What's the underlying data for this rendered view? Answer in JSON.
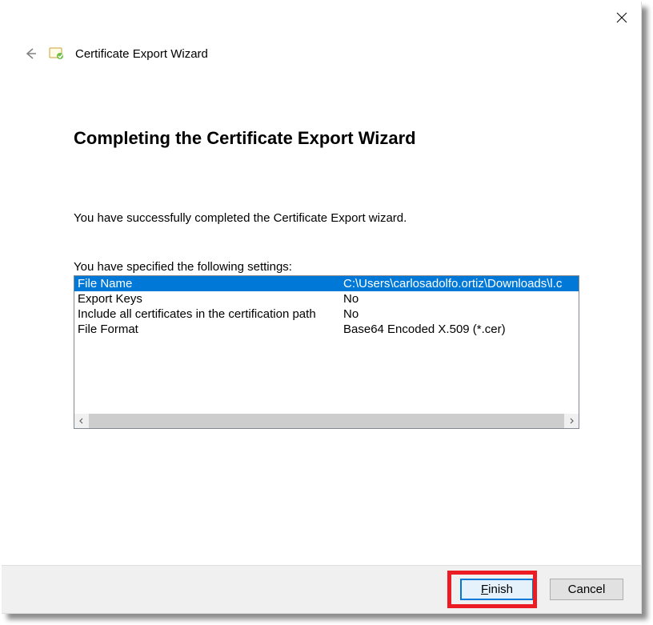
{
  "titlebar": {
    "close_tooltip": "Close"
  },
  "header": {
    "back_tooltip": "Back",
    "wizard_title": "Certificate Export Wizard"
  },
  "content": {
    "heading": "Completing the Certificate Export Wizard",
    "success_text": "You have successfully completed the Certificate Export wizard.",
    "settings_label": "You have specified the following settings:",
    "settings_rows": [
      {
        "key": "File Name",
        "value": "C:\\Users\\carlosadolfo.ortiz\\Downloads\\l.c",
        "selected": true
      },
      {
        "key": "Export Keys",
        "value": "No",
        "selected": false
      },
      {
        "key": "Include all certificates in the certification path",
        "value": "No",
        "selected": false
      },
      {
        "key": "File Format",
        "value": "Base64 Encoded X.509 (*.cer)",
        "selected": false
      }
    ]
  },
  "footer": {
    "finish_label": "Finish",
    "cancel_label": "Cancel"
  }
}
